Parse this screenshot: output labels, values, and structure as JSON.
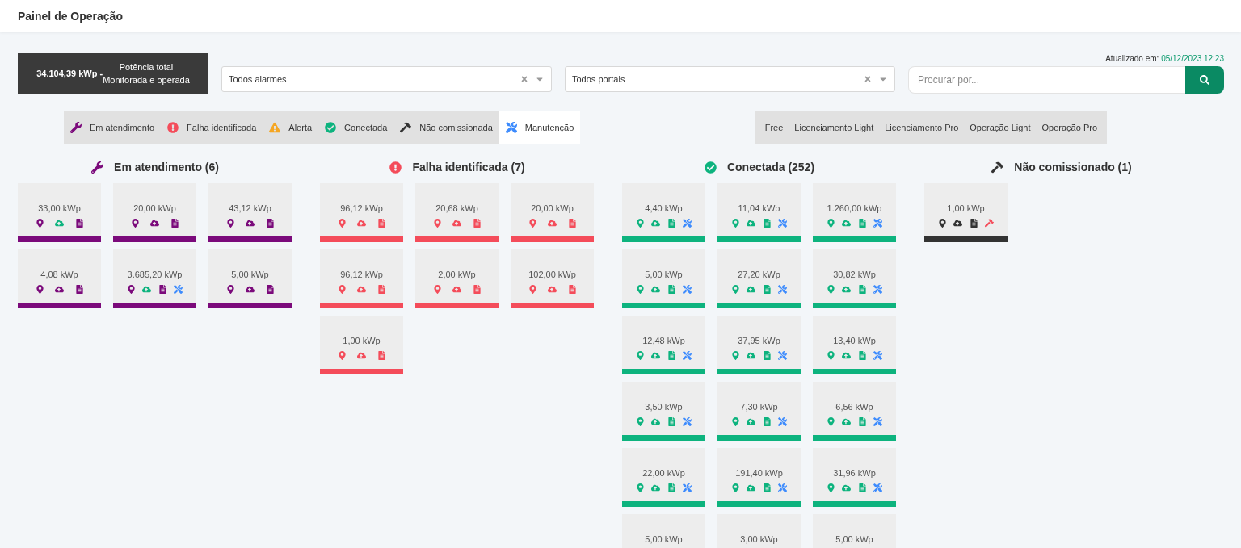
{
  "header": {
    "title": "Painel de Operação"
  },
  "summary": {
    "lines": [
      "**34.104,39 kWp -** Potência total",
      "Monitorada e operada"
    ]
  },
  "filters": [
    {
      "value": "Todos alarmes"
    },
    {
      "value": "Todos portais"
    }
  ],
  "search": {
    "placeholder": "Procurar por..."
  },
  "updated": {
    "label": "Atualizado em:",
    "value": "05/12/2023 12:23"
  },
  "legend": [
    {
      "kind": "wrench",
      "label": "Em atendimento",
      "color": "#7b0a7b",
      "selected": false
    },
    {
      "kind": "exclamation",
      "label": "Falha identificada",
      "color": "#f44c5a",
      "selected": false
    },
    {
      "kind": "warning",
      "label": "Alerta",
      "color": "#f5a623",
      "selected": false
    },
    {
      "kind": "check",
      "label": "Conectada",
      "color": "#0db37e",
      "selected": false
    },
    {
      "kind": "hammer",
      "label": "Não comissionada",
      "color": "#333333",
      "selected": false
    },
    {
      "kind": "tools",
      "label": "Manutenção",
      "color": "#3d8bfd",
      "selected": true
    }
  ],
  "plans": [
    {
      "label": "Free",
      "selected": false
    },
    {
      "label": "Licenciamento Light",
      "selected": false
    },
    {
      "label": "Licenciamento Pro",
      "selected": false
    },
    {
      "label": "Operação Light",
      "selected": false
    },
    {
      "label": "Operação Pro",
      "selected": false
    }
  ],
  "groups": [
    {
      "kind": "wrench",
      "title": "Em atendimento (6)",
      "color": "#7b0a7b",
      "cards": [
        {
          "value": "33,00 kWp",
          "icons": [
            {
              "kind": "pin",
              "color": "#7b0a7b"
            },
            {
              "kind": "cloud",
              "color": "#0db37e"
            },
            {
              "kind": "doc",
              "color": "#7b0a7b"
            }
          ]
        },
        {
          "value": "20,00 kWp",
          "icons": [
            {
              "kind": "pin",
              "color": "#7b0a7b"
            },
            {
              "kind": "cloud",
              "color": "#7b0a7b"
            },
            {
              "kind": "doc",
              "color": "#7b0a7b"
            }
          ]
        },
        {
          "value": "43,12 kWp",
          "icons": [
            {
              "kind": "pin",
              "color": "#7b0a7b"
            },
            {
              "kind": "cloud",
              "color": "#7b0a7b"
            },
            {
              "kind": "doc",
              "color": "#7b0a7b"
            }
          ]
        },
        {
          "value": "4,08 kWp",
          "icons": [
            {
              "kind": "pin",
              "color": "#7b0a7b"
            },
            {
              "kind": "cloud",
              "color": "#7b0a7b"
            },
            {
              "kind": "doc",
              "color": "#7b0a7b"
            }
          ]
        },
        {
          "value": "3.685,20 kWp",
          "icons": [
            {
              "kind": "pin",
              "color": "#7b0a7b"
            },
            {
              "kind": "cloud",
              "color": "#0db37e"
            },
            {
              "kind": "doc",
              "color": "#7b0a7b"
            },
            {
              "kind": "tools",
              "color": "#3d8bfd"
            }
          ]
        },
        {
          "value": "5,00 kWp",
          "icons": [
            {
              "kind": "pin",
              "color": "#7b0a7b"
            },
            {
              "kind": "cloud",
              "color": "#7b0a7b"
            },
            {
              "kind": "doc",
              "color": "#7b0a7b"
            }
          ]
        }
      ]
    },
    {
      "kind": "exclamation",
      "title": "Falha identificada (7)",
      "color": "#f44c5a",
      "cards": [
        {
          "value": "96,12 kWp",
          "icons": [
            {
              "kind": "pin",
              "color": "#f44c5a"
            },
            {
              "kind": "cloud",
              "color": "#f44c5a"
            },
            {
              "kind": "doc",
              "color": "#f44c5a"
            }
          ]
        },
        {
          "value": "20,68 kWp",
          "icons": [
            {
              "kind": "pin",
              "color": "#f44c5a"
            },
            {
              "kind": "cloud",
              "color": "#f44c5a"
            },
            {
              "kind": "doc",
              "color": "#f44c5a"
            }
          ]
        },
        {
          "value": "20,00 kWp",
          "icons": [
            {
              "kind": "pin",
              "color": "#f44c5a"
            },
            {
              "kind": "cloud",
              "color": "#f44c5a"
            },
            {
              "kind": "doc",
              "color": "#f44c5a"
            }
          ]
        },
        {
          "value": "96,12 kWp",
          "icons": [
            {
              "kind": "pin",
              "color": "#f44c5a"
            },
            {
              "kind": "cloud",
              "color": "#f44c5a"
            },
            {
              "kind": "doc",
              "color": "#f44c5a"
            }
          ]
        },
        {
          "value": "2,00 kWp",
          "icons": [
            {
              "kind": "pin",
              "color": "#f44c5a"
            },
            {
              "kind": "cloud",
              "color": "#f44c5a"
            },
            {
              "kind": "doc",
              "color": "#f44c5a"
            }
          ]
        },
        {
          "value": "102,00 kWp",
          "icons": [
            {
              "kind": "pin",
              "color": "#f44c5a"
            },
            {
              "kind": "cloud",
              "color": "#f44c5a"
            },
            {
              "kind": "doc",
              "color": "#f44c5a"
            }
          ]
        },
        {
          "value": "1,00 kWp",
          "icons": [
            {
              "kind": "pin",
              "color": "#f44c5a"
            },
            {
              "kind": "cloud",
              "color": "#f44c5a"
            },
            {
              "kind": "doc",
              "color": "#f44c5a"
            }
          ]
        }
      ]
    },
    {
      "kind": "check",
      "title": "Conectada (252)",
      "color": "#0db37e",
      "cards": [
        {
          "value": "4,40 kWp",
          "icons": [
            {
              "kind": "pin",
              "color": "#0db37e"
            },
            {
              "kind": "cloud",
              "color": "#0db37e"
            },
            {
              "kind": "doc",
              "color": "#0db37e"
            },
            {
              "kind": "tools",
              "color": "#3d8bfd"
            }
          ]
        },
        {
          "value": "11,04 kWp",
          "icons": [
            {
              "kind": "pin",
              "color": "#0db37e"
            },
            {
              "kind": "cloud",
              "color": "#0db37e"
            },
            {
              "kind": "doc",
              "color": "#0db37e"
            },
            {
              "kind": "tools",
              "color": "#3d8bfd"
            }
          ]
        },
        {
          "value": "1.260,00 kWp",
          "icons": [
            {
              "kind": "pin",
              "color": "#0db37e"
            },
            {
              "kind": "cloud",
              "color": "#0db37e"
            },
            {
              "kind": "doc",
              "color": "#0db37e"
            },
            {
              "kind": "tools",
              "color": "#3d8bfd"
            }
          ]
        },
        {
          "value": "5,00 kWp",
          "icons": [
            {
              "kind": "pin",
              "color": "#0db37e"
            },
            {
              "kind": "cloud",
              "color": "#0db37e"
            },
            {
              "kind": "doc",
              "color": "#0db37e"
            },
            {
              "kind": "tools",
              "color": "#3d8bfd"
            }
          ]
        },
        {
          "value": "27,20 kWp",
          "icons": [
            {
              "kind": "pin",
              "color": "#0db37e"
            },
            {
              "kind": "cloud",
              "color": "#0db37e"
            },
            {
              "kind": "doc",
              "color": "#0db37e"
            },
            {
              "kind": "tools",
              "color": "#3d8bfd"
            }
          ]
        },
        {
          "value": "30,82 kWp",
          "icons": [
            {
              "kind": "pin",
              "color": "#0db37e"
            },
            {
              "kind": "cloud",
              "color": "#0db37e"
            },
            {
              "kind": "doc",
              "color": "#0db37e"
            },
            {
              "kind": "tools",
              "color": "#3d8bfd"
            }
          ]
        },
        {
          "value": "12,48 kWp",
          "icons": [
            {
              "kind": "pin",
              "color": "#0db37e"
            },
            {
              "kind": "cloud",
              "color": "#0db37e"
            },
            {
              "kind": "doc",
              "color": "#0db37e"
            },
            {
              "kind": "tools",
              "color": "#3d8bfd"
            }
          ]
        },
        {
          "value": "37,95 kWp",
          "icons": [
            {
              "kind": "pin",
              "color": "#0db37e"
            },
            {
              "kind": "cloud",
              "color": "#0db37e"
            },
            {
              "kind": "doc",
              "color": "#0db37e"
            },
            {
              "kind": "tools",
              "color": "#3d8bfd"
            }
          ]
        },
        {
          "value": "13,40 kWp",
          "icons": [
            {
              "kind": "pin",
              "color": "#0db37e"
            },
            {
              "kind": "cloud",
              "color": "#0db37e"
            },
            {
              "kind": "doc",
              "color": "#0db37e"
            },
            {
              "kind": "tools",
              "color": "#3d8bfd"
            }
          ]
        },
        {
          "value": "3,50 kWp",
          "icons": [
            {
              "kind": "pin",
              "color": "#0db37e"
            },
            {
              "kind": "cloud",
              "color": "#0db37e"
            },
            {
              "kind": "doc",
              "color": "#0db37e"
            },
            {
              "kind": "tools",
              "color": "#3d8bfd"
            }
          ]
        },
        {
          "value": "7,30 kWp",
          "icons": [
            {
              "kind": "pin",
              "color": "#0db37e"
            },
            {
              "kind": "cloud",
              "color": "#0db37e"
            },
            {
              "kind": "doc",
              "color": "#0db37e"
            },
            {
              "kind": "tools",
              "color": "#3d8bfd"
            }
          ]
        },
        {
          "value": "6,56 kWp",
          "icons": [
            {
              "kind": "pin",
              "color": "#0db37e"
            },
            {
              "kind": "cloud",
              "color": "#0db37e"
            },
            {
              "kind": "doc",
              "color": "#0db37e"
            },
            {
              "kind": "tools",
              "color": "#3d8bfd"
            }
          ]
        },
        {
          "value": "22,00 kWp",
          "icons": [
            {
              "kind": "pin",
              "color": "#0db37e"
            },
            {
              "kind": "cloud",
              "color": "#0db37e"
            },
            {
              "kind": "doc",
              "color": "#0db37e"
            },
            {
              "kind": "tools",
              "color": "#3d8bfd"
            }
          ]
        },
        {
          "value": "191,40 kWp",
          "icons": [
            {
              "kind": "pin",
              "color": "#0db37e"
            },
            {
              "kind": "cloud",
              "color": "#0db37e"
            },
            {
              "kind": "doc",
              "color": "#0db37e"
            },
            {
              "kind": "tools",
              "color": "#3d8bfd"
            }
          ]
        },
        {
          "value": "31,96 kWp",
          "icons": [
            {
              "kind": "pin",
              "color": "#0db37e"
            },
            {
              "kind": "cloud",
              "color": "#0db37e"
            },
            {
              "kind": "doc",
              "color": "#0db37e"
            },
            {
              "kind": "tools",
              "color": "#3d8bfd"
            }
          ]
        },
        {
          "value": "5,00 kWp"
        },
        {
          "value": "3,00 kWp"
        },
        {
          "value": "5,00 kWp"
        }
      ]
    },
    {
      "kind": "hammer",
      "title": "Não comissionado (1)",
      "color": "#333333",
      "cards": [
        {
          "value": "1,00 kWp",
          "icons": [
            {
              "kind": "pin",
              "color": "#333333"
            },
            {
              "kind": "cloud",
              "color": "#333333"
            },
            {
              "kind": "doc",
              "color": "#333333"
            },
            {
              "kind": "hammer",
              "color": "#f44c5a"
            }
          ]
        }
      ]
    }
  ]
}
